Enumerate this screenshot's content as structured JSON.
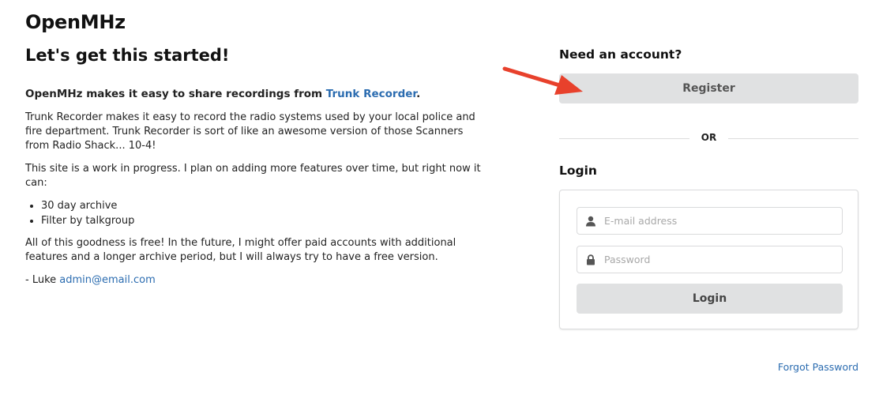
{
  "site": {
    "title": "OpenMHz"
  },
  "page": {
    "heading": "Let's get this started!"
  },
  "intro": {
    "lead_text": "OpenMHz makes it easy to share recordings from ",
    "lead_link": "Trunk Recorder",
    "lead_end": ".",
    "paragraph1": "Trunk Recorder makes it easy to record the radio systems used by your local police and fire department. Trunk Recorder is sort of like an awesome version of those Scanners from Radio Shack... 10-4!",
    "paragraph2": "This site is a work in progress. I plan on adding more features over time, but right now it can:",
    "features": [
      "30 day archive",
      "Filter by talkgroup"
    ],
    "paragraph3": "All of this goodness is free! In the future, I might offer paid accounts with additional features and a longer archive period, but I will always try to have a free version.",
    "signature_name": "- Luke ",
    "signature_email": "admin@email.com"
  },
  "register": {
    "heading": "Need an account?",
    "button_label": "Register",
    "or_label": "OR"
  },
  "login": {
    "heading": "Login",
    "email_placeholder": "E-mail address",
    "email_icon": "user-icon",
    "password_placeholder": "Password",
    "password_icon": "lock-icon",
    "button_label": "Login",
    "forgot_label": "Forgot Password"
  },
  "colors": {
    "link": "#2b6cb0",
    "button_bg": "#e0e1e2",
    "annotation_arrow": "#e8412c"
  }
}
